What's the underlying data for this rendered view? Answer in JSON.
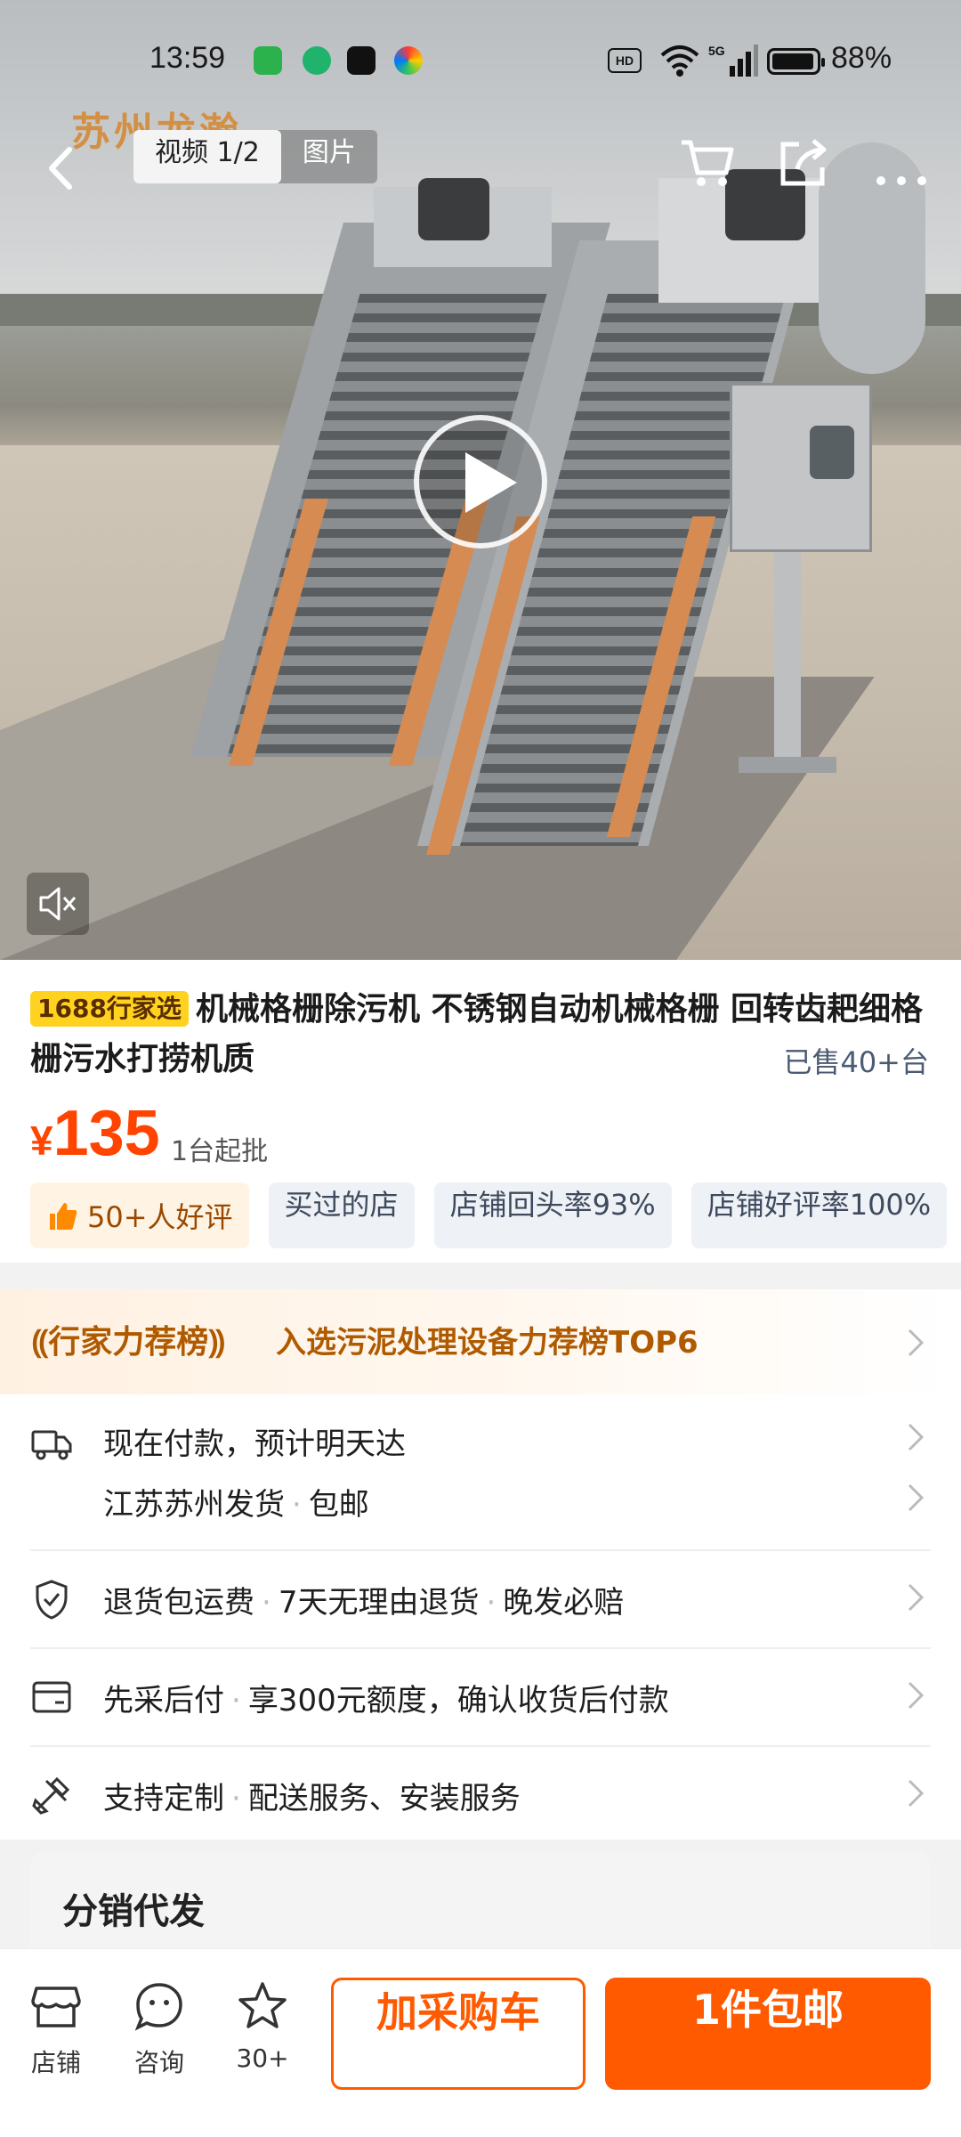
{
  "statusbar": {
    "time": "13:59",
    "battery": "88%",
    "network": "5G",
    "hd": "HD"
  },
  "topbar": {
    "tabs": [
      {
        "label": "视频 1/2",
        "active": true
      },
      {
        "label": "图片",
        "active": false
      }
    ]
  },
  "hero": {
    "brand_logo": "苏州龙瀚"
  },
  "product": {
    "tag": "1688行家选",
    "title": "机械格栅除污机 不锈钢自动机械格栅 回转齿耙细格栅污水打捞机质",
    "sold": "已售40+台",
    "price_symbol": "¥",
    "price": "135",
    "moq": "1台起批",
    "badges": [
      {
        "label": "50+人好评",
        "type": "good"
      },
      {
        "label": "买过的店"
      },
      {
        "label": "店铺回头率93%"
      },
      {
        "label": "店铺好评率100%"
      }
    ]
  },
  "rank": {
    "label": "行家力荐榜",
    "text": "入选污泥处理设备力荐榜TOP6"
  },
  "list": {
    "shipping": {
      "main": "现在付款，预计明天达",
      "origin": "江苏苏州发货",
      "postage": "包邮"
    },
    "returns": {
      "a": "退货包运费",
      "b": "7天无理由退货",
      "c": "晚发必赔"
    },
    "paylater": {
      "a": "先采后付",
      "b": "享300元额度，确认收货后付款"
    },
    "custom": {
      "a": "支持定制",
      "b": "配送服务、安装服务"
    }
  },
  "distrib": {
    "title": "分销代发"
  },
  "bottom": {
    "store": "店铺",
    "consult": "咨询",
    "fav": "30+",
    "add_cart": "加采购车",
    "buy": "1件包邮"
  },
  "colors": {
    "accent": "#ff5a00",
    "price": "#ff4400",
    "tag_bg": "#ffd21f"
  }
}
